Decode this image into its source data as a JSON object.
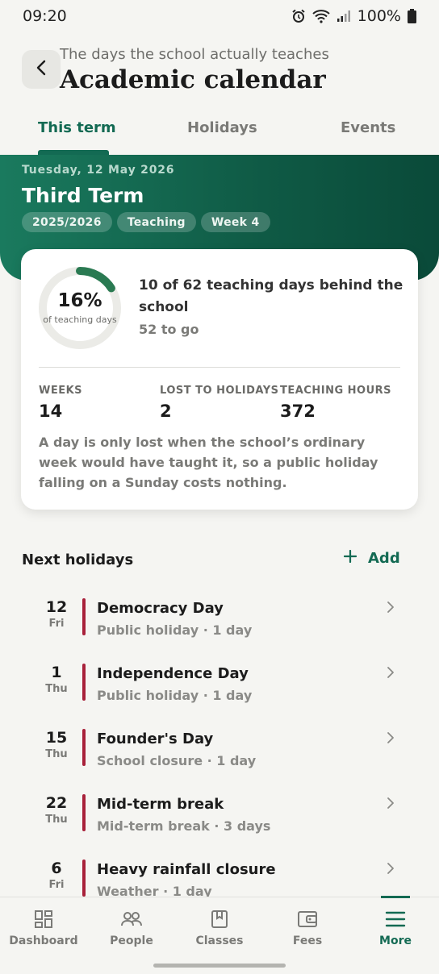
{
  "status": {
    "time": "09:20",
    "battery": "100%"
  },
  "header": {
    "subtitle": "The days the school actually teaches",
    "title": "Academic calendar"
  },
  "tabs": [
    {
      "label": "This term"
    },
    {
      "label": "Holidays"
    },
    {
      "label": "Events"
    }
  ],
  "banner": {
    "date": "Tuesday, 12 May 2026",
    "term": "Third Term",
    "chips": [
      "2025/2026",
      "Teaching",
      "Week 4"
    ]
  },
  "progress": {
    "percent_label": "16%",
    "percent_value": 0.16,
    "ring_caption": "of teaching days",
    "headline": "10 of 62 teaching days behind the school",
    "remaining": "52 to go",
    "stats": [
      {
        "label": "WEEKS",
        "value": "14"
      },
      {
        "label": "LOST TO HOLIDAYS",
        "value": "2"
      },
      {
        "label": "TEACHING HOURS",
        "value": "372"
      }
    ],
    "note": "A day is only lost when the school’s ordinary week would have taught it, so a public holiday falling on a Sunday costs nothing."
  },
  "holidays_section": {
    "title": "Next holidays",
    "add_label": "Add",
    "items": [
      {
        "day": "12",
        "dow": "Fri",
        "name": "Democracy Day",
        "meta": "Public holiday · 1 day"
      },
      {
        "day": "1",
        "dow": "Thu",
        "name": "Independence Day",
        "meta": "Public holiday · 1 day"
      },
      {
        "day": "15",
        "dow": "Thu",
        "name": "Founder's Day",
        "meta": "School closure · 1 day"
      },
      {
        "day": "22",
        "dow": "Thu",
        "name": "Mid-term break",
        "meta": "Mid-term break · 3 days"
      },
      {
        "day": "6",
        "dow": "Fri",
        "name": "Heavy rainfall closure",
        "meta": "Weather · 1 day"
      }
    ]
  },
  "bottom_nav": [
    {
      "label": "Dashboard",
      "icon": "dashboard-icon"
    },
    {
      "label": "People",
      "icon": "people-icon"
    },
    {
      "label": "Classes",
      "icon": "book-icon"
    },
    {
      "label": "Fees",
      "icon": "wallet-icon"
    },
    {
      "label": "More",
      "icon": "menu-icon"
    }
  ],
  "colors": {
    "accent": "#136a53",
    "holiday_bar": "#a8213a",
    "banner": "#0f5a45"
  }
}
